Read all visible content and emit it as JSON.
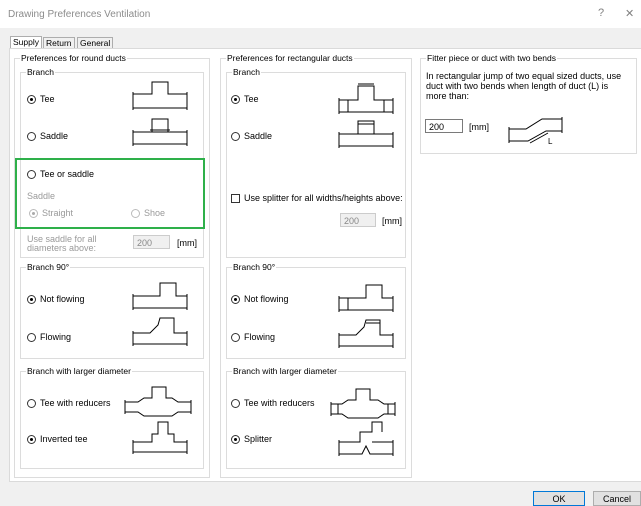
{
  "window": {
    "title": "Drawing Preferences Ventilation",
    "help": "?",
    "close": "✕"
  },
  "tabs": [
    "Supply",
    "Return",
    "General"
  ],
  "round": {
    "title": "Preferences for round ducts",
    "branch": {
      "title": "Branch",
      "tee": "Tee",
      "saddle": "Saddle",
      "tee_or_saddle": "Tee or saddle",
      "saddle_label": "Saddle",
      "straight": "Straight",
      "shoe": "Shoe",
      "use_saddle_label": "Use saddle for all diameters above:",
      "use_saddle_value": "200",
      "unit": "[mm]"
    },
    "branch90": {
      "title": "Branch 90°",
      "not_flowing": "Not flowing",
      "flowing": "Flowing"
    },
    "larger": {
      "title": "Branch with larger diameter",
      "tee_reducers": "Tee with reducers",
      "inverted": "Inverted tee"
    }
  },
  "rect": {
    "title": "Preferences for rectangular ducts",
    "branch": {
      "title": "Branch",
      "tee": "Tee",
      "saddle": "Saddle",
      "splitter_label": "Use splitter for all widths/heights above:",
      "splitter_value": "200",
      "unit": "[mm]"
    },
    "branch90": {
      "title": "Branch 90°",
      "not_flowing": "Not flowing",
      "flowing": "Flowing"
    },
    "larger": {
      "title": "Branch with larger diameter",
      "tee_reducers": "Tee with reducers",
      "splitter": "Splitter"
    }
  },
  "fitter": {
    "title": "Fitter piece or duct with two bends",
    "text": "In rectangular jump of two equal sized ducts, use duct with two bends when length of duct (L) is more than:",
    "value": "200",
    "unit": "[mm]",
    "diagram_letter": "L"
  },
  "buttons": {
    "ok": "OK",
    "cancel": "Cancel"
  }
}
